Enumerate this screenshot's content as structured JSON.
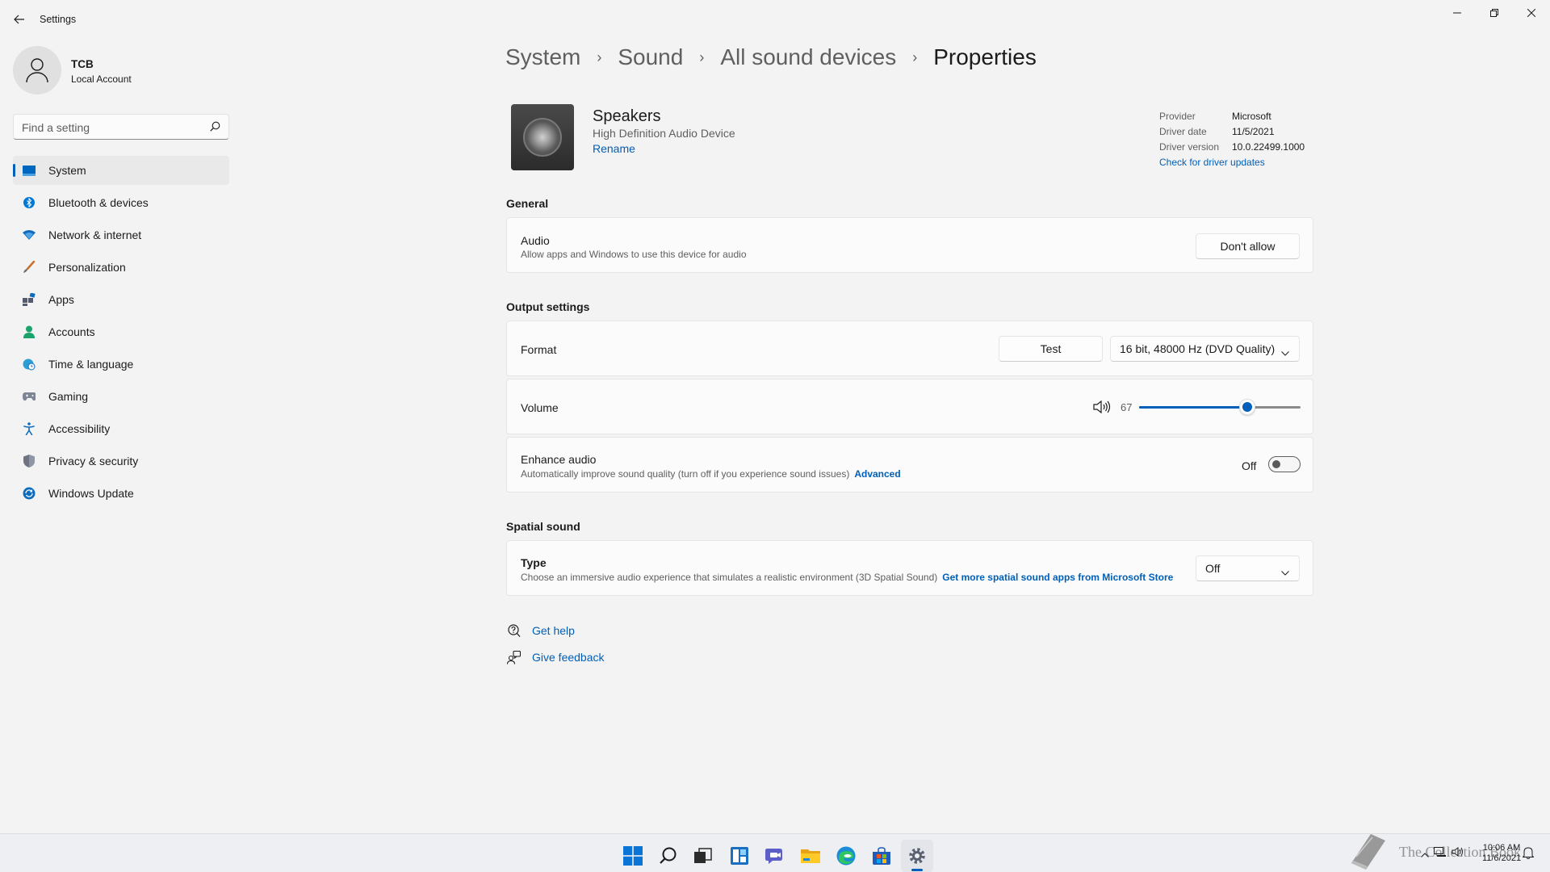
{
  "window": {
    "title": "Settings"
  },
  "profile": {
    "name": "TCB",
    "account_type": "Local Account"
  },
  "search": {
    "placeholder": "Find a setting"
  },
  "sidebar": {
    "items": [
      {
        "label": "System",
        "icon": "system-icon",
        "active": true
      },
      {
        "label": "Bluetooth & devices",
        "icon": "bluetooth-icon"
      },
      {
        "label": "Network & internet",
        "icon": "wifi-icon"
      },
      {
        "label": "Personalization",
        "icon": "brush-icon"
      },
      {
        "label": "Apps",
        "icon": "apps-icon"
      },
      {
        "label": "Accounts",
        "icon": "person-icon"
      },
      {
        "label": "Time & language",
        "icon": "globe-clock-icon"
      },
      {
        "label": "Gaming",
        "icon": "gamepad-icon"
      },
      {
        "label": "Accessibility",
        "icon": "accessibility-icon"
      },
      {
        "label": "Privacy & security",
        "icon": "shield-icon"
      },
      {
        "label": "Windows Update",
        "icon": "update-icon"
      }
    ]
  },
  "breadcrumb": {
    "items": [
      "System",
      "Sound",
      "All sound devices",
      "Properties"
    ],
    "separator": "›"
  },
  "device": {
    "name": "Speakers",
    "description": "High Definition Audio Device",
    "rename_label": "Rename"
  },
  "driver": {
    "provider_label": "Provider",
    "provider": "Microsoft",
    "date_label": "Driver date",
    "date": "11/5/2021",
    "version_label": "Driver version",
    "version": "10.0.22499.1000",
    "update_link": "Check for driver updates"
  },
  "general": {
    "section_title": "General",
    "audio_title": "Audio",
    "audio_desc": "Allow apps and Windows to use this device for audio",
    "audio_button": "Don't allow"
  },
  "output": {
    "section_title": "Output settings",
    "format_title": "Format",
    "test_button": "Test",
    "format_value": "16 bit, 48000 Hz (DVD Quality)",
    "volume_title": "Volume",
    "volume_value": "67",
    "volume_fraction": 0.67,
    "enhance_title": "Enhance audio",
    "enhance_desc": "Automatically improve sound quality (turn off if you experience sound issues)",
    "enhance_link": "Advanced",
    "enhance_state": "Off"
  },
  "spatial": {
    "section_title": "Spatial sound",
    "type_title": "Type",
    "type_desc": "Choose an immersive audio experience that simulates a realistic environment (3D Spatial Sound)",
    "type_link": "Get more spatial sound apps from Microsoft Store",
    "type_value": "Off"
  },
  "help": {
    "get_help": "Get help",
    "give_feedback": "Give feedback"
  },
  "taskbar": {
    "apps": [
      "start-icon",
      "search-icon",
      "task-view-icon",
      "widgets-icon",
      "teams-chat-icon",
      "file-explorer-icon",
      "edge-icon",
      "store-icon",
      "settings-icon"
    ],
    "time": "10:06 AM",
    "date": "11/6/2021",
    "watermark": "The Collection Book"
  },
  "colors": {
    "accent": "#005fb8",
    "background": "#f3f3f3",
    "card": "#fbfbfb"
  }
}
